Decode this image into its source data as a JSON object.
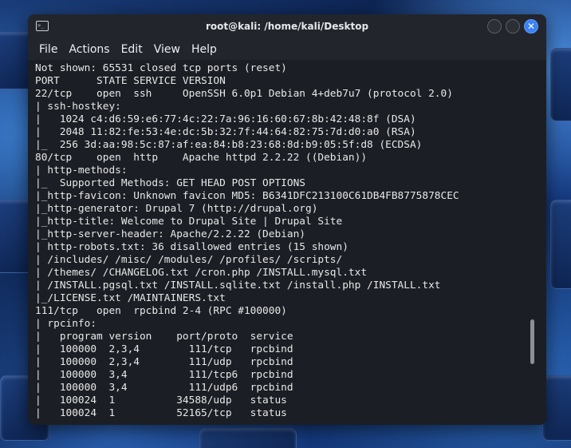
{
  "window": {
    "title": "root@kali: /home/kali/Desktop"
  },
  "menu": {
    "items": [
      "File",
      "Actions",
      "Edit",
      "View",
      "Help"
    ]
  },
  "terminal": {
    "lines": [
      "Not shown: 65531 closed tcp ports (reset)",
      "PORT      STATE SERVICE VERSION",
      "22/tcp    open  ssh     OpenSSH 6.0p1 Debian 4+deb7u7 (protocol 2.0)",
      "| ssh-hostkey:",
      "|   1024 c4:d6:59:e6:77:4c:22:7a:96:16:60:67:8b:42:48:8f (DSA)",
      "|   2048 11:82:fe:53:4e:dc:5b:32:7f:44:64:82:75:7d:d0:a0 (RSA)",
      "|_  256 3d:aa:98:5c:87:af:ea:84:b8:23:68:8d:b9:05:5f:d8 (ECDSA)",
      "80/tcp    open  http    Apache httpd 2.2.22 ((Debian))",
      "| http-methods:",
      "|_  Supported Methods: GET HEAD POST OPTIONS",
      "|_http-favicon: Unknown favicon MD5: B6341DFC213100C61DB4FB8775878CEC",
      "|_http-generator: Drupal 7 (http://drupal.org)",
      "|_http-title: Welcome to Drupal Site | Drupal Site",
      "|_http-server-header: Apache/2.2.22 (Debian)",
      "| http-robots.txt: 36 disallowed entries (15 shown)",
      "| /includes/ /misc/ /modules/ /profiles/ /scripts/",
      "| /themes/ /CHANGELOG.txt /cron.php /INSTALL.mysql.txt",
      "| /INSTALL.pgsql.txt /INSTALL.sqlite.txt /install.php /INSTALL.txt",
      "|_/LICENSE.txt /MAINTAINERS.txt",
      "111/tcp   open  rpcbind 2-4 (RPC #100000)",
      "| rpcinfo:",
      "|   program version    port/proto  service",
      "|   100000  2,3,4        111/tcp   rpcbind",
      "|   100000  2,3,4        111/udp   rpcbind",
      "|   100000  3,4          111/tcp6  rpcbind",
      "|   100000  3,4          111/udp6  rpcbind",
      "|   100024  1          34588/udp   status",
      "|   100024  1          52165/tcp   status"
    ]
  },
  "colors": {
    "terminal_bg": "#1b1e24",
    "titlebar_bg": "#22252b",
    "text": "#e8e8e8",
    "close_button": "#3b82f6"
  },
  "icons": {
    "app": "terminal-icon",
    "minimize": "minimize-icon",
    "maximize": "maximize-icon",
    "close": "close-icon"
  }
}
